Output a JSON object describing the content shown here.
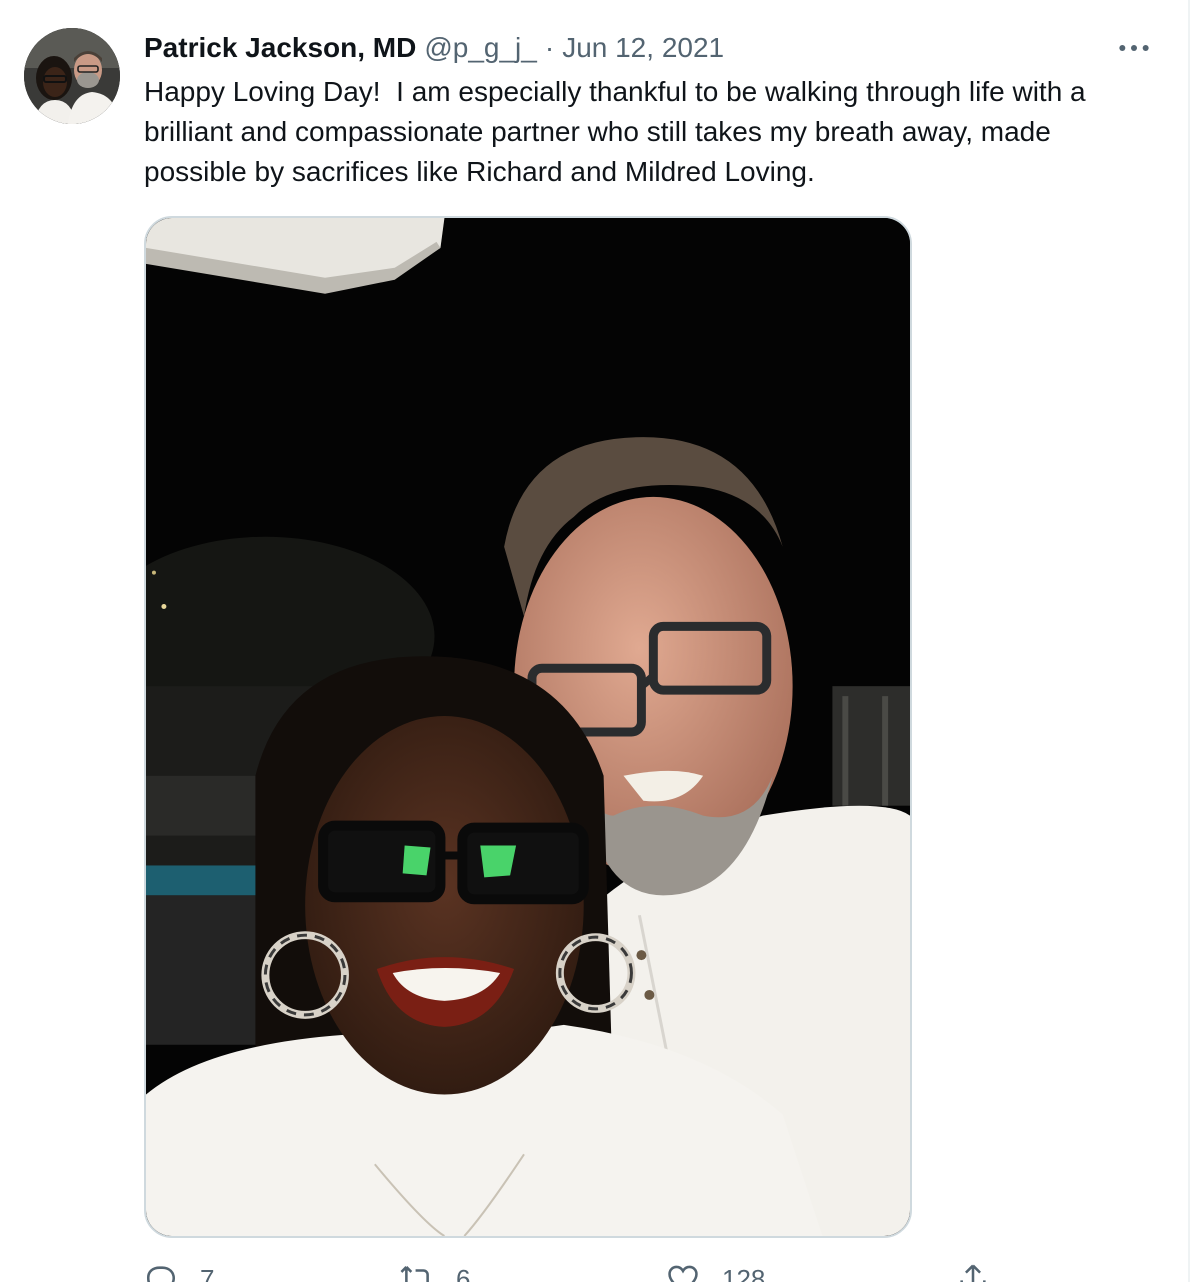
{
  "tweet": {
    "author": {
      "display_name": "Patrick Jackson, MD",
      "handle": "@p_g_j_"
    },
    "separator": "·",
    "date": "Jun 12, 2021",
    "text": "Happy Loving Day!  I am especially thankful to be walking through life with a\nbrilliant and compassionate partner who still takes my breath away, made\npossible by sacrifices like Richard and Mildred Loving.",
    "actions": {
      "reply": {
        "icon": "reply-icon",
        "count": "7"
      },
      "retweet": {
        "icon": "retweet-icon",
        "count": "6"
      },
      "like": {
        "icon": "heart-icon",
        "count": "128"
      },
      "share": {
        "icon": "share-icon"
      }
    },
    "more_icon": "more-options-icon"
  },
  "colors": {
    "text_primary": "#0f1419",
    "text_secondary": "#536471",
    "border": "#cfd9de"
  }
}
